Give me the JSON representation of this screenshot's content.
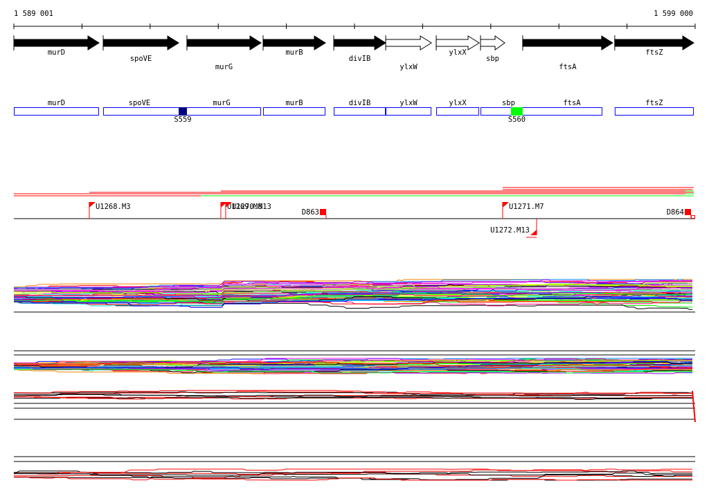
{
  "ruler": {
    "start_label": "1 589 001",
    "end_label": "1 599 000",
    "start_bp": 1589001,
    "end_bp": 1599000
  },
  "genes": [
    {
      "name": "murD",
      "start": 1589001,
      "end": 1590251,
      "filled": true
    },
    {
      "name": "spoVE",
      "start": 1590312,
      "end": 1591420,
      "filled": true
    },
    {
      "name": "murG",
      "start": 1591541,
      "end": 1592629,
      "filled": true
    },
    {
      "name": "murB",
      "start": 1592659,
      "end": 1593574,
      "filled": true
    },
    {
      "name": "divIB",
      "start": 1593696,
      "end": 1594458,
      "filled": true
    },
    {
      "name": "ylxW",
      "start": 1594458,
      "end": 1595129,
      "filled": false
    },
    {
      "name": "ylxX",
      "start": 1595200,
      "end": 1595830,
      "filled": false
    },
    {
      "name": "sbp",
      "start": 1595850,
      "end": 1596206,
      "filled": false
    },
    {
      "name": "ftsA",
      "start": 1596469,
      "end": 1597790,
      "filled": true
    },
    {
      "name": "ftsZ",
      "start": 1597820,
      "end": 1598980,
      "filled": true
    }
  ],
  "boxes": [
    {
      "name": "murD",
      "start": 1589001,
      "end": 1590251
    },
    {
      "name": "spoVE",
      "start": 1590312,
      "end": 1592629,
      "label2": "murG"
    },
    {
      "name": "murB",
      "start": 1592659,
      "end": 1593574
    },
    {
      "name": "divIB",
      "start": 1593696,
      "end": 1594458
    },
    {
      "name": "ylxW",
      "start": 1594458,
      "end": 1595129
    },
    {
      "name": "ylxX",
      "start": 1595200,
      "end": 1595830
    },
    {
      "name": "sbp",
      "start": 1595850,
      "end": 1597638,
      "label2": "ftsA"
    },
    {
      "name": "ftsZ",
      "start": 1597820,
      "end": 1598980
    }
  ],
  "sites": [
    {
      "name": "S559",
      "start": 1591420,
      "end": 1591541,
      "color": "#000080"
    },
    {
      "name": "S560",
      "start": 1596297,
      "end": 1596469,
      "color": "#00ff00"
    }
  ],
  "markers": [
    {
      "name": "U1268.M3",
      "pos": 1590108,
      "type": "up"
    },
    {
      "name": "U1269.M8",
      "pos": 1592039,
      "type": "up"
    },
    {
      "name": "U1270.M13",
      "pos": 1592110,
      "type": "up"
    },
    {
      "name": "D863",
      "pos": 1593584,
      "type": "square"
    },
    {
      "name": "U1271.M7",
      "pos": 1596175,
      "type": "up"
    },
    {
      "name": "U1272.M13",
      "pos": 1596673,
      "type": "down"
    },
    {
      "name": "D864",
      "pos": 1598939,
      "type": "square"
    }
  ],
  "colors": {
    "gene_fill": "#000000",
    "box_border": "#0000ff",
    "marker": "#ff0000",
    "series": [
      "#ff0000",
      "#00ff00",
      "#0000ff",
      "#ff00ff",
      "#00ffff",
      "#ffff00",
      "#808080",
      "#ff8000",
      "#000000",
      "#0080ff",
      "#80ff00",
      "#ff0080",
      "#8000ff",
      "#c0c0c0"
    ]
  }
}
